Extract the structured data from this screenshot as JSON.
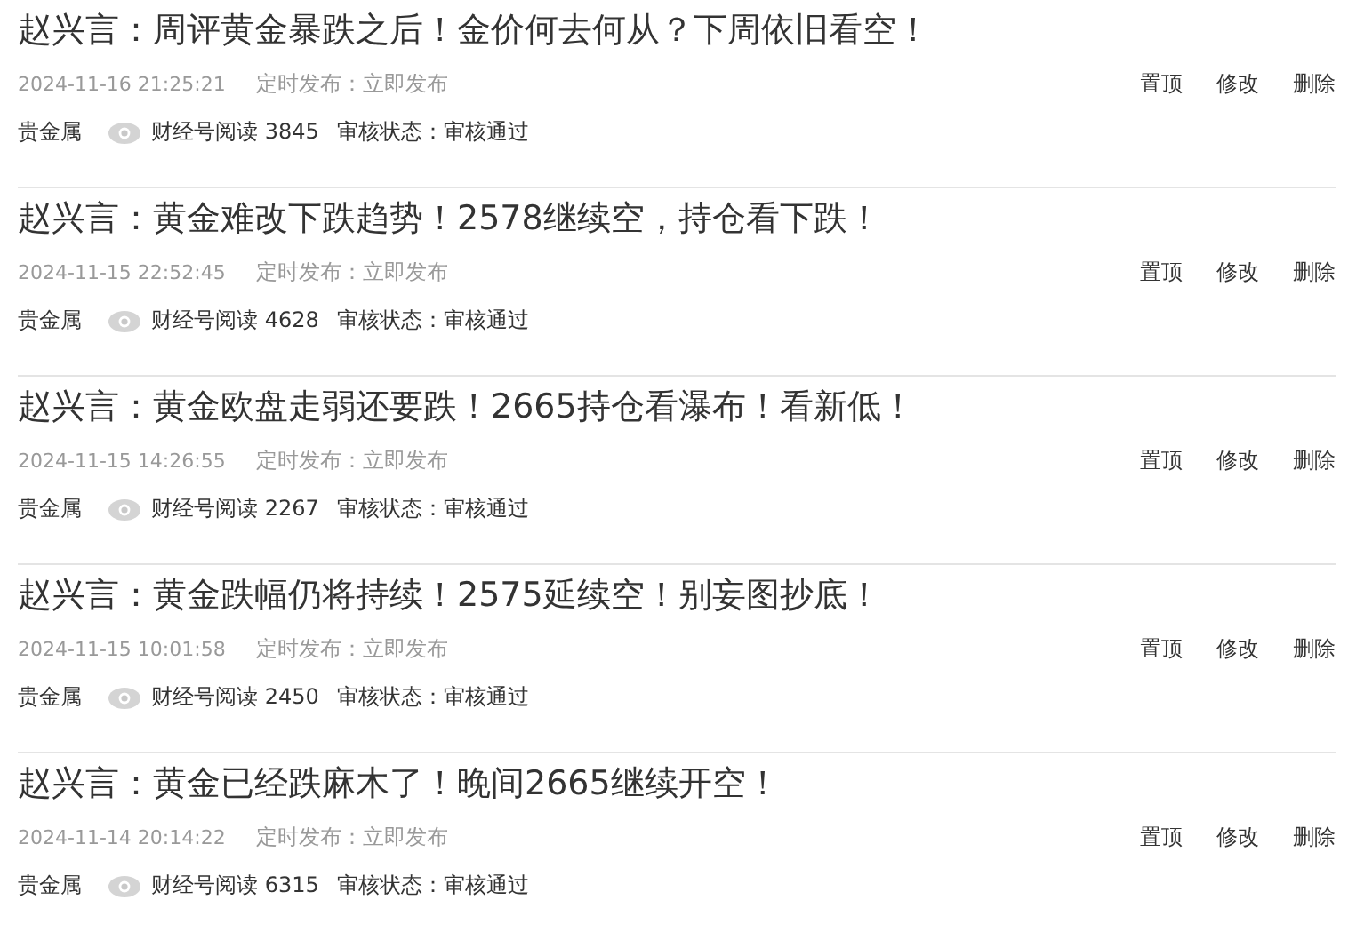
{
  "articles": [
    {
      "title": "赵兴言：周评黄金暴跌之后！金价何去何从？下周依旧看空！",
      "time": "2024-11-16 21:25:21",
      "schedule": "定时发布：立即发布",
      "actions": [
        "置顶",
        "修改",
        "删除"
      ],
      "category": "贵金属",
      "reads": "财经号阅读 3845",
      "review": "审核状态：审核通过"
    },
    {
      "title": "赵兴言：黄金难改下跌趋势！2578继续空，持仓看下跌！",
      "time": "2024-11-15 22:52:45",
      "schedule": "定时发布：立即发布",
      "actions": [
        "置顶",
        "修改",
        "删除"
      ],
      "category": "贵金属",
      "reads": "财经号阅读 4628",
      "review": "审核状态：审核通过"
    },
    {
      "title": "赵兴言：黄金欧盘走弱还要跌！2665持仓看瀑布！看新低！",
      "time": "2024-11-15 14:26:55",
      "schedule": "定时发布：立即发布",
      "actions": [
        "置顶",
        "修改",
        "删除"
      ],
      "category": "贵金属",
      "reads": "财经号阅读 2267",
      "review": "审核状态：审核通过"
    },
    {
      "title": "赵兴言：黄金跌幅仍将持续！2575延续空！别妄图抄底！",
      "time": "2024-11-15 10:01:58",
      "schedule": "定时发布：立即发布",
      "actions": [
        "置顶",
        "修改",
        "删除"
      ],
      "category": "贵金属",
      "reads": "财经号阅读 2450",
      "review": "审核状态：审核通过"
    },
    {
      "title": "赵兴言：黄金已经跌麻木了！晚间2665继续开空！",
      "time": "2024-11-14 20:14:22",
      "schedule": "定时发布：立即发布",
      "actions": [
        "置顶",
        "修改",
        "删除"
      ],
      "category": "贵金属",
      "reads": "财经号阅读 6315",
      "review": "审核状态：审核通过"
    }
  ]
}
